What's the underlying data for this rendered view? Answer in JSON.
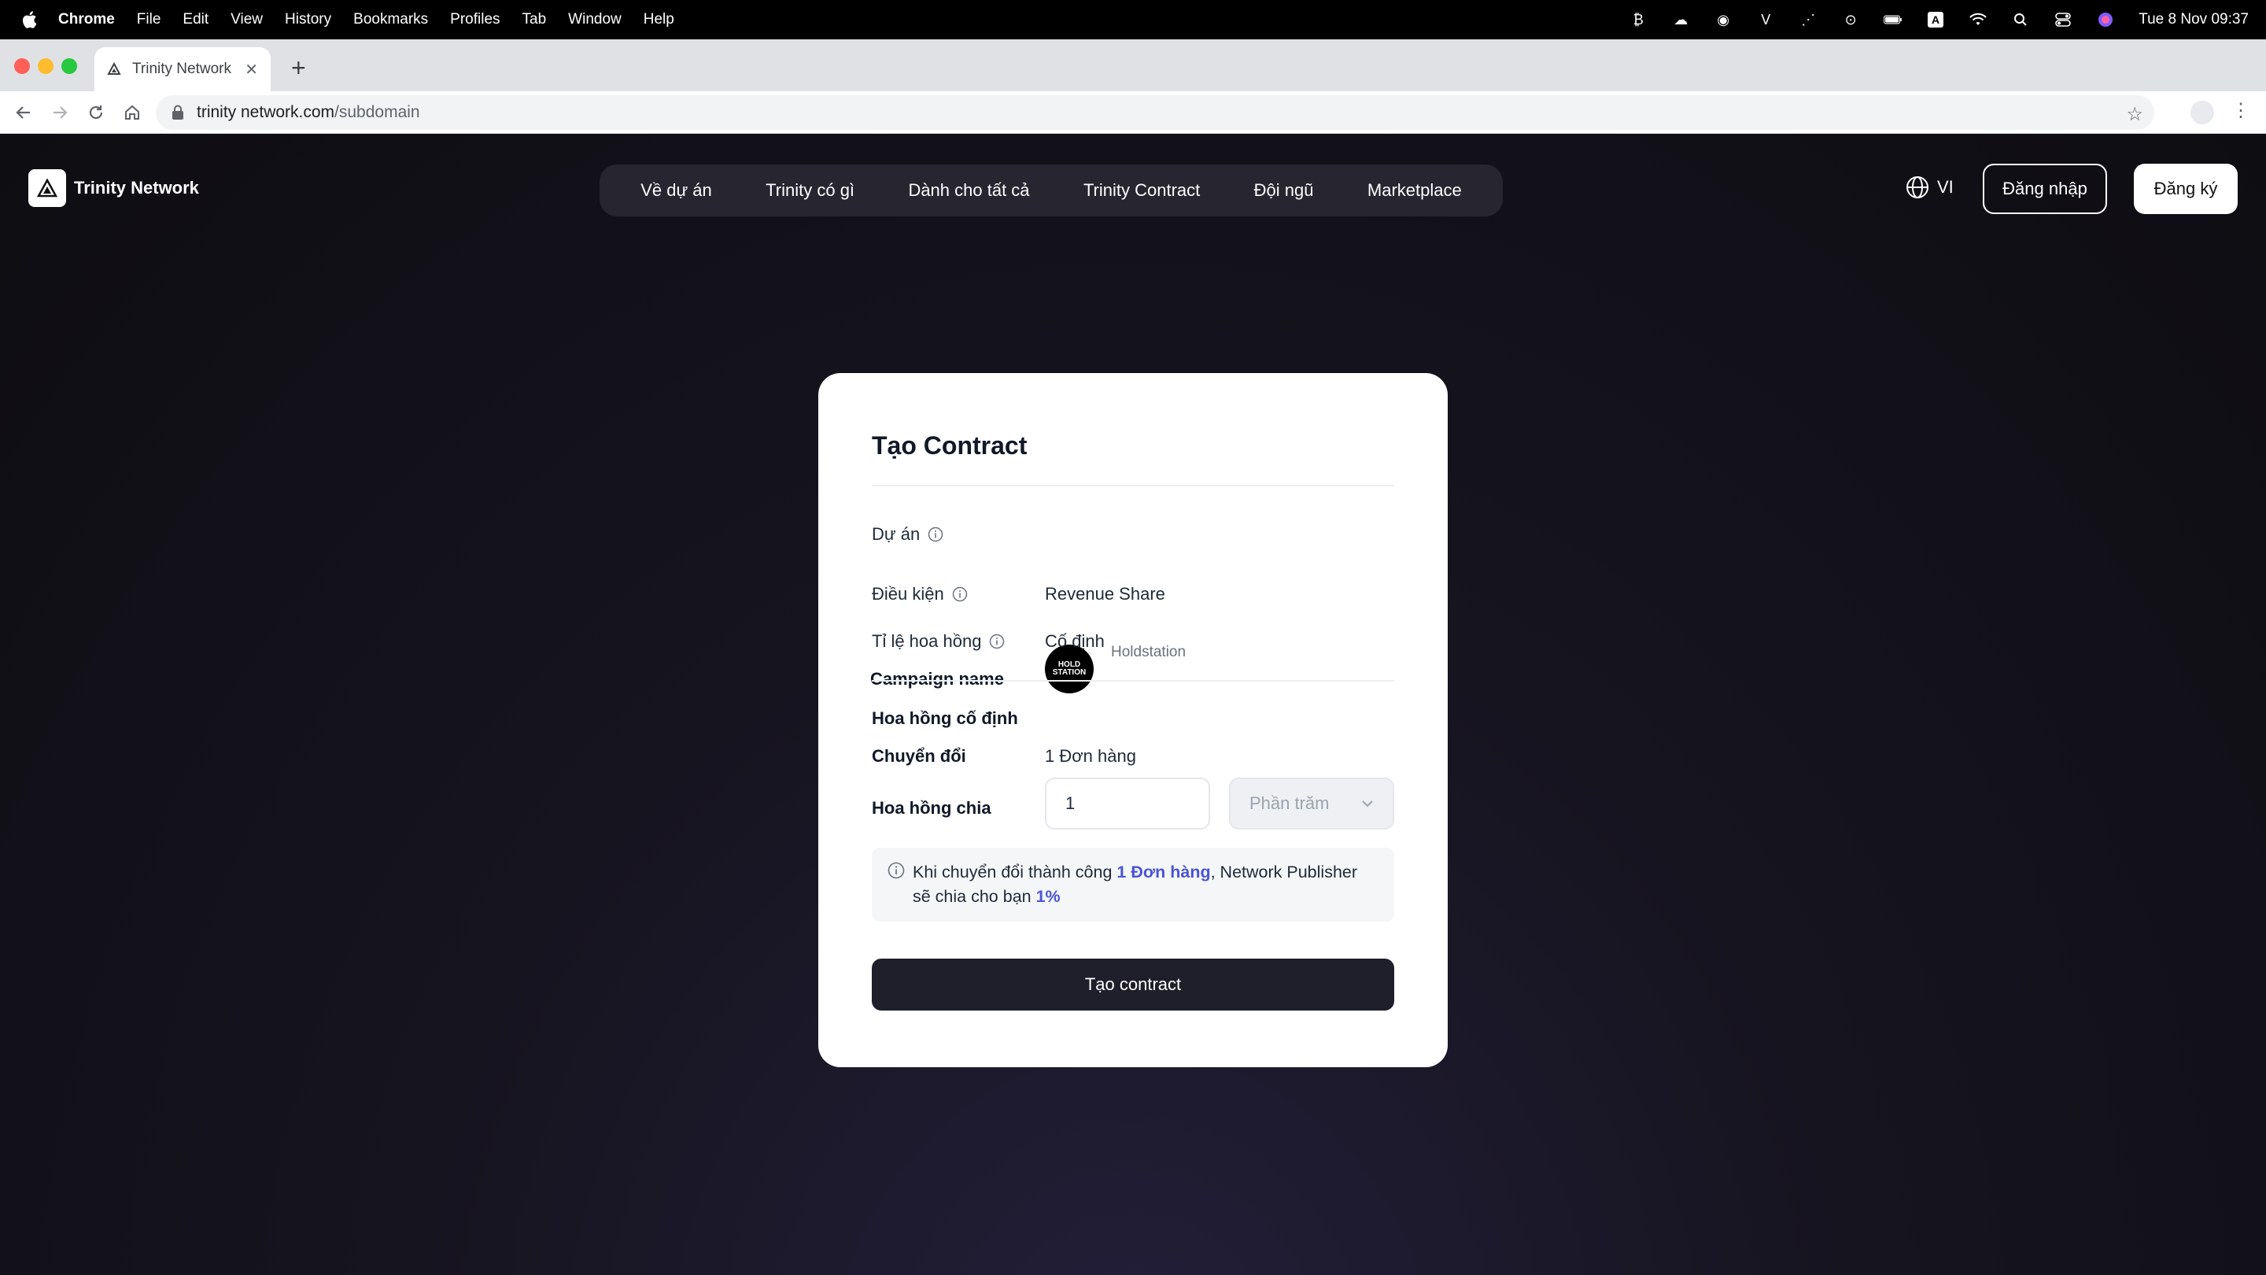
{
  "menubar": {
    "app_name": "Chrome",
    "items": [
      "File",
      "Edit",
      "View",
      "History",
      "Bookmarks",
      "Profiles",
      "Tab",
      "Window",
      "Help"
    ],
    "clock": "Tue 8 Nov  09:37"
  },
  "browser": {
    "tab_title": "Trinity Network",
    "url_host": "trinity network.com",
    "url_path": "/subdomain"
  },
  "site": {
    "brand": "Trinity Network",
    "nav": [
      "Về dự án",
      "Trinity có gì",
      "Dành cho tất cả",
      "Trinity Contract",
      "Đội ngũ",
      "Marketplace"
    ],
    "language": "VI",
    "login_label": "Đăng nhập",
    "signup_label": "Đăng ký"
  },
  "form": {
    "title": "Tạo Contract",
    "project_label": "Dự án",
    "project_org": "Holdstation",
    "project_name": "Campaign name",
    "project_logo_text": "HOLD STATION",
    "condition_label": "Điều kiện",
    "condition_value": "Revenue Share",
    "rate_label": "Tỉ lệ hoa hồng",
    "rate_value": "Cố định",
    "section_title": "Hoa hồng cố định",
    "conversion_label": "Chuyển đổi",
    "conversion_value": "1 Đơn hàng",
    "commission_label": "Hoa hồng chia",
    "commission_value": "1",
    "unit_placeholder": "Phần trăm",
    "notice": {
      "part1": "Khi chuyển đổi thành công ",
      "highlight1": "1 Đơn hàng",
      "part2": ", Network Publisher",
      "part3": "sẽ chia cho bạn ",
      "highlight2": "1%"
    },
    "submit_label": "Tạo contract"
  },
  "colors": {
    "accent": "#4a55d6",
    "primary_button": "#1f1f2b",
    "page_background": "#0f0e14"
  }
}
